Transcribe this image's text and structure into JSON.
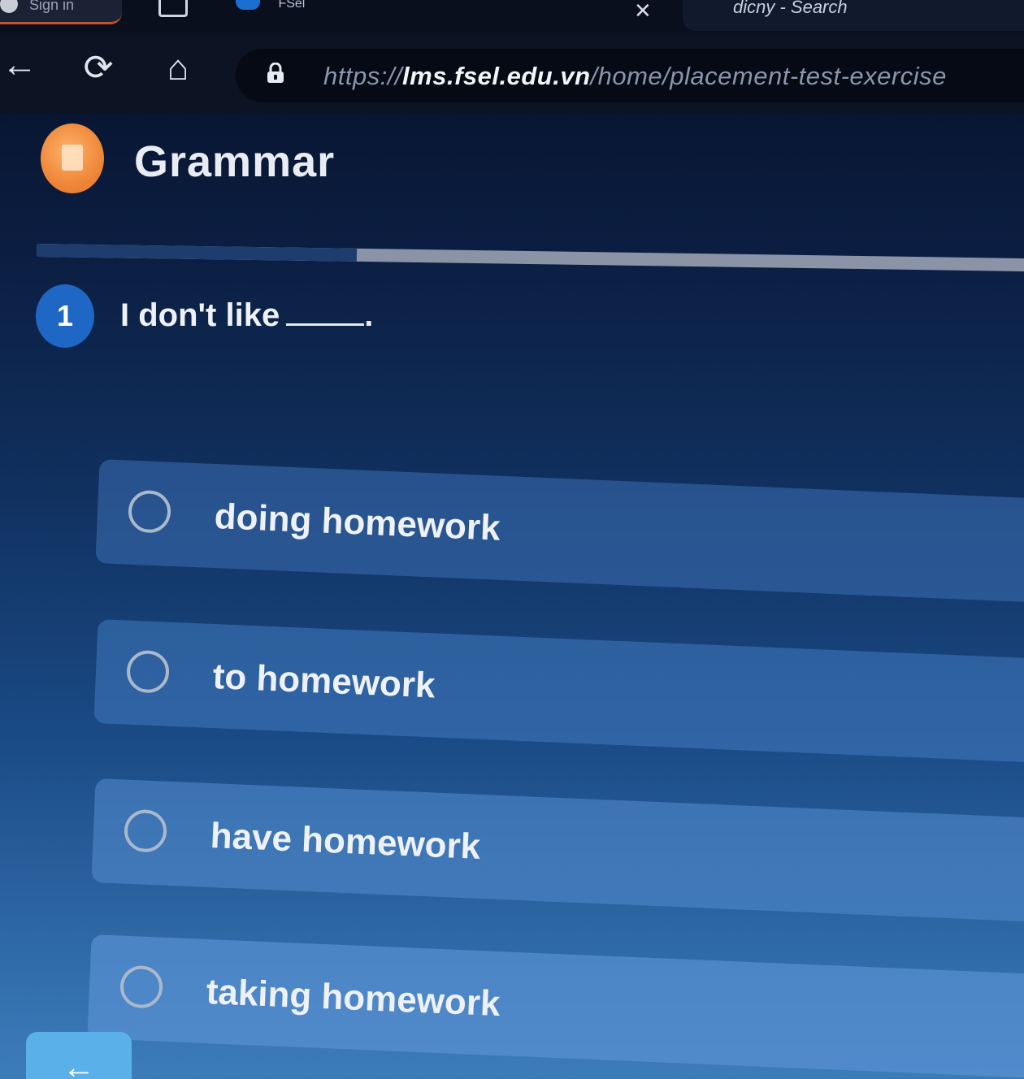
{
  "browser": {
    "tabs": {
      "signin_label": "Sign in",
      "site_tab_label": "FSel",
      "search_tab_label": "dicny - Search"
    },
    "nav": {
      "back_glyph": "←",
      "reload_glyph": "⟳",
      "home_glyph": "⌂"
    },
    "url": {
      "prefix": "https://",
      "host": "lms.fsel.edu.vn",
      "path": "/home/placement-test-exercise"
    }
  },
  "section": {
    "title": "Grammar",
    "icon": "book-icon",
    "accent_color": "#f08a3c"
  },
  "progress": {
    "fraction": 0.32
  },
  "question": {
    "number": "1",
    "text": "I don't like",
    "trailing": "."
  },
  "options": [
    {
      "label": "doing homework"
    },
    {
      "label": "to homework"
    },
    {
      "label": "have homework"
    },
    {
      "label": "taking homework"
    }
  ],
  "footer": {
    "prev_glyph": "←"
  }
}
